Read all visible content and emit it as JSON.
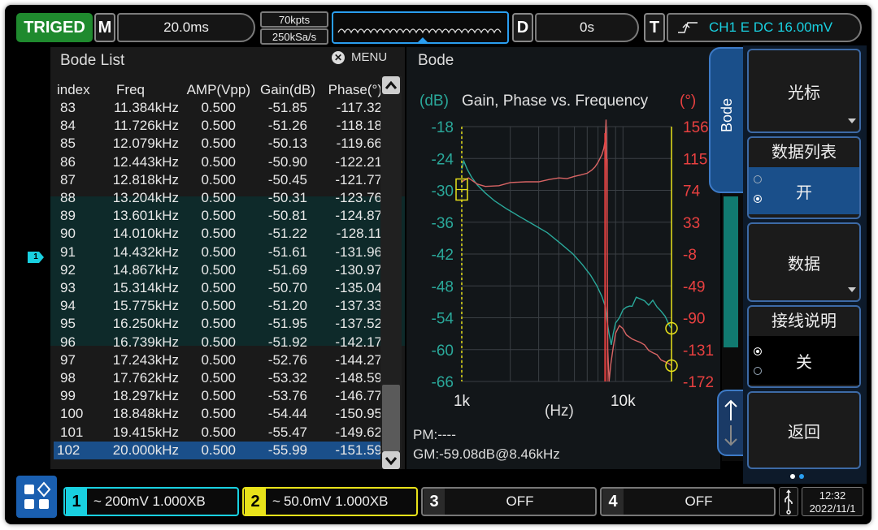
{
  "topbar": {
    "trig_status": "TRIGED",
    "m_label": "M",
    "timebase": "20.0ms",
    "mem_depth": "70kpts",
    "sample_rate": "250kSa/s",
    "d_label": "D",
    "delay": "0s",
    "t_label": "T",
    "trigger_info": "CH1 E DC 16.00mV"
  },
  "bode_list": {
    "title": "Bode List",
    "menu_label": "MENU",
    "headers": [
      "index",
      "Freq",
      "AMP(Vpp)",
      "Gain(dB)",
      "Phase(°)"
    ],
    "rows": [
      [
        "83",
        "11.384kHz",
        "0.500",
        "-51.85",
        "-117.32"
      ],
      [
        "84",
        "11.726kHz",
        "0.500",
        "-51.26",
        "-118.18"
      ],
      [
        "85",
        "12.079kHz",
        "0.500",
        "-50.13",
        "-119.66"
      ],
      [
        "86",
        "12.443kHz",
        "0.500",
        "-50.90",
        "-122.21"
      ],
      [
        "87",
        "12.818kHz",
        "0.500",
        "-50.45",
        "-121.77"
      ],
      [
        "88",
        "13.204kHz",
        "0.500",
        "-50.31",
        "-123.76"
      ],
      [
        "89",
        "13.601kHz",
        "0.500",
        "-50.81",
        "-124.87"
      ],
      [
        "90",
        "14.010kHz",
        "0.500",
        "-51.22",
        "-128.11"
      ],
      [
        "91",
        "14.432kHz",
        "0.500",
        "-51.61",
        "-131.96"
      ],
      [
        "92",
        "14.867kHz",
        "0.500",
        "-51.69",
        "-130.97"
      ],
      [
        "93",
        "15.314kHz",
        "0.500",
        "-50.70",
        "-135.04"
      ],
      [
        "94",
        "15.775kHz",
        "0.500",
        "-51.20",
        "-137.33"
      ],
      [
        "95",
        "16.250kHz",
        "0.500",
        "-51.95",
        "-137.52"
      ],
      [
        "96",
        "16.739kHz",
        "0.500",
        "-51.92",
        "-142.17"
      ],
      [
        "97",
        "17.243kHz",
        "0.500",
        "-52.76",
        "-144.27"
      ],
      [
        "98",
        "17.762kHz",
        "0.500",
        "-53.32",
        "-148.59"
      ],
      [
        "99",
        "18.297kHz",
        "0.500",
        "-53.76",
        "-146.77"
      ],
      [
        "100",
        "18.848kHz",
        "0.500",
        "-54.44",
        "-150.95"
      ],
      [
        "101",
        "19.415kHz",
        "0.500",
        "-55.47",
        "-149.62"
      ],
      [
        "102",
        "20.000kHz",
        "0.500",
        "-55.99",
        "-151.59"
      ]
    ],
    "selected_index": "102"
  },
  "bode_plot": {
    "panel_title": "Bode",
    "side_tab": "Bode",
    "left_unit": "(dB)",
    "right_unit": "(°)",
    "x_unit": "(Hz)",
    "pm_text": "PM:----",
    "gm_text": "GM:-59.08dB@8.46kHz"
  },
  "chart_data": {
    "type": "line",
    "title": "Gain, Phase vs. Frequency",
    "xlabel": "(Hz)",
    "xscale": "log",
    "x_ticks": [
      "1k",
      "10k"
    ],
    "xlim": [
      1000,
      20000
    ],
    "y_left_label": "(dB)",
    "y_left_ticks": [
      -18,
      -24,
      -30,
      -36,
      -42,
      -48,
      -54,
      -60,
      -66
    ],
    "ylim_left": [
      -66,
      -18
    ],
    "y_right_label": "(°)",
    "y_right_ticks": [
      156,
      115,
      74,
      33,
      -8,
      -49,
      -90,
      -131,
      -172
    ],
    "ylim_right": [
      -172,
      156
    ],
    "grid": true,
    "series": [
      {
        "axis": "left",
        "color": "#2aa89a",
        "x": [
          1000,
          1030,
          1080,
          1150,
          1250,
          1400,
          1600,
          1900,
          2300,
          2800,
          3400,
          4100,
          4900,
          5600,
          6300,
          6900,
          7400,
          7800,
          8000,
          8200,
          8460,
          8700,
          9000,
          9500,
          10000,
          10500,
          11000,
          11400,
          12079,
          12818,
          13601,
          14432,
          15314,
          16250,
          17243,
          18297,
          19415,
          20000
        ],
        "y": [
          -26,
          -24.5,
          -26,
          -27.5,
          -29,
          -30.5,
          -32,
          -33.5,
          -35,
          -36.5,
          -38,
          -40,
          -42,
          -44,
          -46,
          -48,
          -50,
          -52,
          -55,
          -57,
          -59.1,
          -57,
          -55,
          -54,
          -52.5,
          -52,
          -51.8,
          -51.85,
          -50.13,
          -50.45,
          -50.81,
          -51.61,
          -50.7,
          -51.95,
          -52.76,
          -53.76,
          -55.47,
          -55.99
        ]
      },
      {
        "axis": "right",
        "color": "#d86464",
        "x": [
          1000,
          1100,
          1250,
          1400,
          1700,
          2000,
          2500,
          3000,
          3500,
          4000,
          4500,
          5000,
          5500,
          6000,
          6400,
          6700,
          7000,
          7200,
          7400,
          7600,
          7750,
          7850,
          7950,
          8050,
          8200,
          8400,
          8700,
          9000,
          9500,
          10000,
          10500,
          11384,
          12079,
          12818,
          13601,
          14432,
          15314,
          16250,
          17243,
          18297,
          19415,
          20000
        ],
        "y": [
          85,
          90,
          82,
          79,
          80,
          84,
          85,
          85,
          88,
          90,
          89,
          92,
          94,
          96,
          100,
          104,
          110,
          115,
          120,
          128,
          138,
          165,
          100,
          -131,
          -172,
          -150,
          -128,
          -110,
          -100,
          -104,
          -112,
          -117.32,
          -119.66,
          -121.77,
          -124.87,
          -131.96,
          -135.04,
          -137.52,
          -144.27,
          -146.77,
          -149.62,
          -151.59
        ]
      }
    ]
  },
  "side_menu": {
    "cursor_label": "光标",
    "data_list_label": "数据列表",
    "data_list_value": "开",
    "data_label": "数据",
    "wiring_label": "接线说明",
    "wiring_value": "关",
    "back_label": "返回"
  },
  "bottom": {
    "ch1_num": "1",
    "ch1_text": "200mV 1.000XB",
    "ch2_num": "2",
    "ch2_text": "50.0mV 1.000XB",
    "ch3_num": "3",
    "ch3_text": "OFF",
    "ch4_num": "4",
    "ch4_text": "OFF",
    "time": "12:32",
    "date": "2022/11/1"
  },
  "colors": {
    "ch1": "#19d0e0",
    "ch2": "#e8e21a",
    "gain": "#2aa89a",
    "phase": "#d86464",
    "menu_blue": "#1a4f8a",
    "triged": "#1f8a2e"
  }
}
